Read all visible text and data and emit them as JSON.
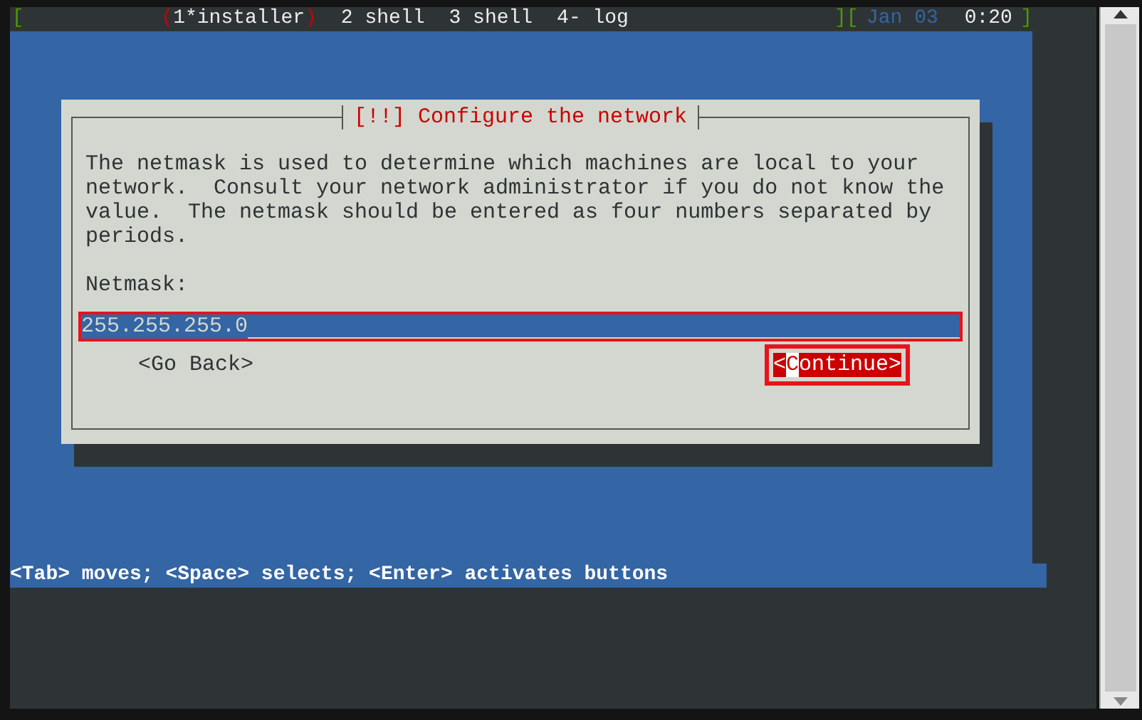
{
  "status_bar": {
    "open_bracket": "[",
    "windows": [
      {
        "label": "(1*installer)",
        "selected": true
      },
      {
        "label": "2 shell",
        "selected": false
      },
      {
        "label": "3 shell",
        "selected": false
      },
      {
        "label": "4- log",
        "selected": false
      }
    ],
    "mid_brackets": "][",
    "date": "Jan 03",
    "time": "0:20",
    "close_bracket": "]"
  },
  "dialog": {
    "title": "[!!] Configure the network",
    "description": "The netmask is used to determine which machines are local to your network.  Consult your network administrator if you do not know the value.  The netmask should be entered as four numbers separated by periods.",
    "field_label": "Netmask:",
    "field_value": "255.255.255.0",
    "field_highlighted": true,
    "buttons": [
      {
        "label": "<Go Back>",
        "selected": false
      },
      {
        "label": "<Continue>",
        "selected": true
      }
    ]
  },
  "help_line": "<Tab> moves; <Space> selects; <Enter> activates buttons"
}
